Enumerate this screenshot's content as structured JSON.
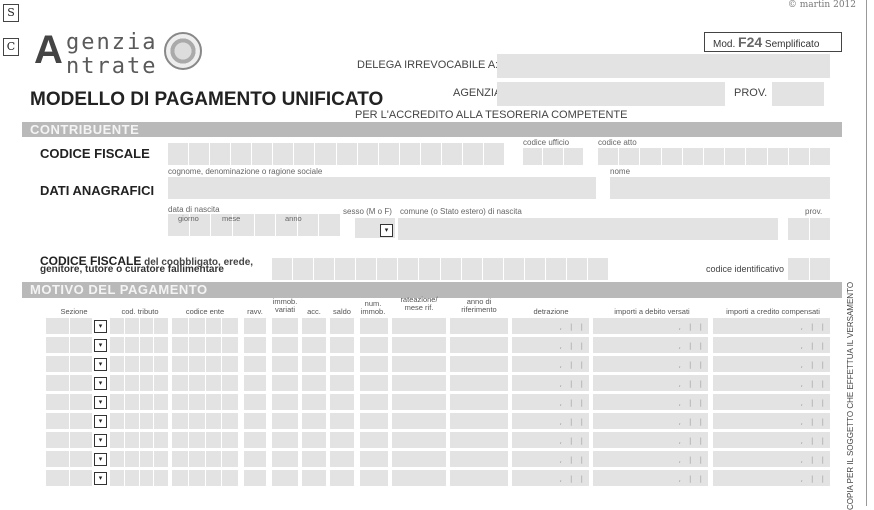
{
  "copyright": "© martin 2012",
  "side_buttons": [
    "S",
    "C"
  ],
  "logo": {
    "line1": "genzia",
    "line2": "ntrate",
    "letter": "A"
  },
  "mod_box": {
    "prefix": "Mod.",
    "code": "F24",
    "suffix": "Semplificato"
  },
  "header": {
    "title": "MODELLO DI PAGAMENTO UNIFICATO",
    "delega_label": "DELEGA IRREVOCABILE A:",
    "delega_value": "",
    "agenzia_label": "AGENZIA",
    "agenzia_value": "",
    "prov_label": "PROV.",
    "prov_value": "",
    "accredito": "PER L'ACCREDITO ALLA TESORERIA COMPETENTE"
  },
  "contribuente": {
    "section": "CONTRIBUENTE",
    "codice_fiscale": "CODICE FISCALE",
    "codice_ufficio": "codice ufficio",
    "codice_atto": "codice atto",
    "dati_anagrafici": "DATI ANAGRAFICI",
    "cognome": "cognome, denominazione o ragione sociale",
    "nome": "nome",
    "data_nascita": "data di nascita",
    "giorno": "giorno",
    "mese": "mese",
    "anno": "anno",
    "sesso": "sesso (M o F)",
    "comune": "comune (o Stato estero) di nascita",
    "prov": "prov.",
    "coobbligato_bold": "CODICE FISCALE",
    "coobbligato_rest": " del coobbligato, erede,",
    "coobbligato_line2": "genitore, tutore o curatore fallimentare",
    "codice_identificativo": "codice identificativo"
  },
  "motivo": {
    "section": "MOTIVO DEL PAGAMENTO",
    "columns": {
      "sezione": "Sezione",
      "cod_tributo": "cod. tributo",
      "codice_ente": "codice ente",
      "ravv": "ravv.",
      "immob": "immob. variati",
      "acc": "acc.",
      "saldo": "saldo",
      "num_immob": "num. immob.",
      "rateazione": "rateazione/ mese rif.",
      "anno_rif": "anno di riferimento",
      "detrazione": "detrazione",
      "debito": "importi a debito versati",
      "credito": "importi a credito compensati"
    },
    "row_count": 9,
    "dropdown_glyph": "▾",
    "decimal_mark": ", | |"
  },
  "vertical_text": "COPIA PER IL SOGGETTO CHE EFFETTUA IL VERSAMENTO"
}
